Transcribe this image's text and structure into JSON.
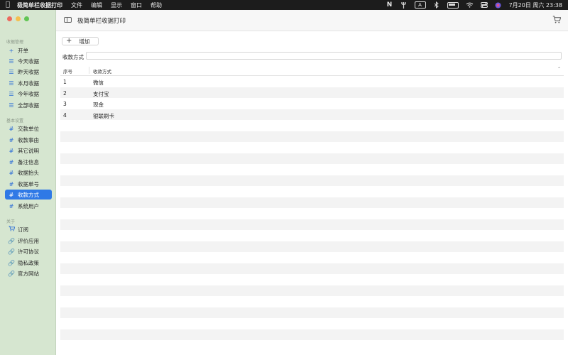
{
  "menubar": {
    "app_name": "极简单栏收据打印",
    "menus": [
      "文件",
      "编辑",
      "显示",
      "窗口",
      "帮助"
    ],
    "status_icons": [
      "n-icon",
      "fork-icon",
      "input-a-icon",
      "bluetooth-icon",
      "battery-icon",
      "wifi-icon",
      "control-center-icon",
      "siri-icon"
    ],
    "input_label": "A",
    "clock": "7月20日 周六 23:38"
  },
  "window": {
    "title": "极简单栏收据打印"
  },
  "sidebar": {
    "sections": [
      {
        "title": "收据管理",
        "items": [
          {
            "label": "开单",
            "icon": "plus-icon"
          },
          {
            "label": "今天收据",
            "icon": "list-icon"
          },
          {
            "label": "昨天收据",
            "icon": "list-icon"
          },
          {
            "label": "本月收据",
            "icon": "list-icon"
          },
          {
            "label": "今年收据",
            "icon": "list-icon"
          },
          {
            "label": "全部收据",
            "icon": "list-icon"
          }
        ]
      },
      {
        "title": "基本设置",
        "items": [
          {
            "label": "交款单位",
            "icon": "hash-icon"
          },
          {
            "label": "收款事由",
            "icon": "hash-icon"
          },
          {
            "label": "其它说明",
            "icon": "hash-icon"
          },
          {
            "label": "备注信息",
            "icon": "hash-icon"
          },
          {
            "label": "收据抬头",
            "icon": "hash-icon"
          },
          {
            "label": "收据单号",
            "icon": "hash-icon"
          },
          {
            "label": "收款方式",
            "icon": "hash-icon",
            "active": true
          },
          {
            "label": "系统用户",
            "icon": "hash-icon"
          }
        ]
      },
      {
        "title": "关于",
        "items": [
          {
            "label": "订阅",
            "icon": "cart-icon"
          },
          {
            "label": "评价应用",
            "icon": "link-icon"
          },
          {
            "label": "许可协议",
            "icon": "link-icon"
          },
          {
            "label": "隐私政策",
            "icon": "link-icon"
          },
          {
            "label": "官方网站",
            "icon": "link-icon"
          }
        ]
      }
    ]
  },
  "main": {
    "add_button": "增加",
    "filter": {
      "label": "收款方式",
      "value": "",
      "placeholder": ""
    },
    "table": {
      "columns": [
        "序号",
        "收款方式"
      ],
      "rows": [
        [
          "1",
          "微信"
        ],
        [
          "2",
          "支付宝"
        ],
        [
          "3",
          "现金"
        ],
        [
          "4",
          "银联刷卡"
        ]
      ]
    }
  },
  "colors": {
    "accent": "#2f79e6",
    "sidebar_bg": "#d6e6d0"
  }
}
